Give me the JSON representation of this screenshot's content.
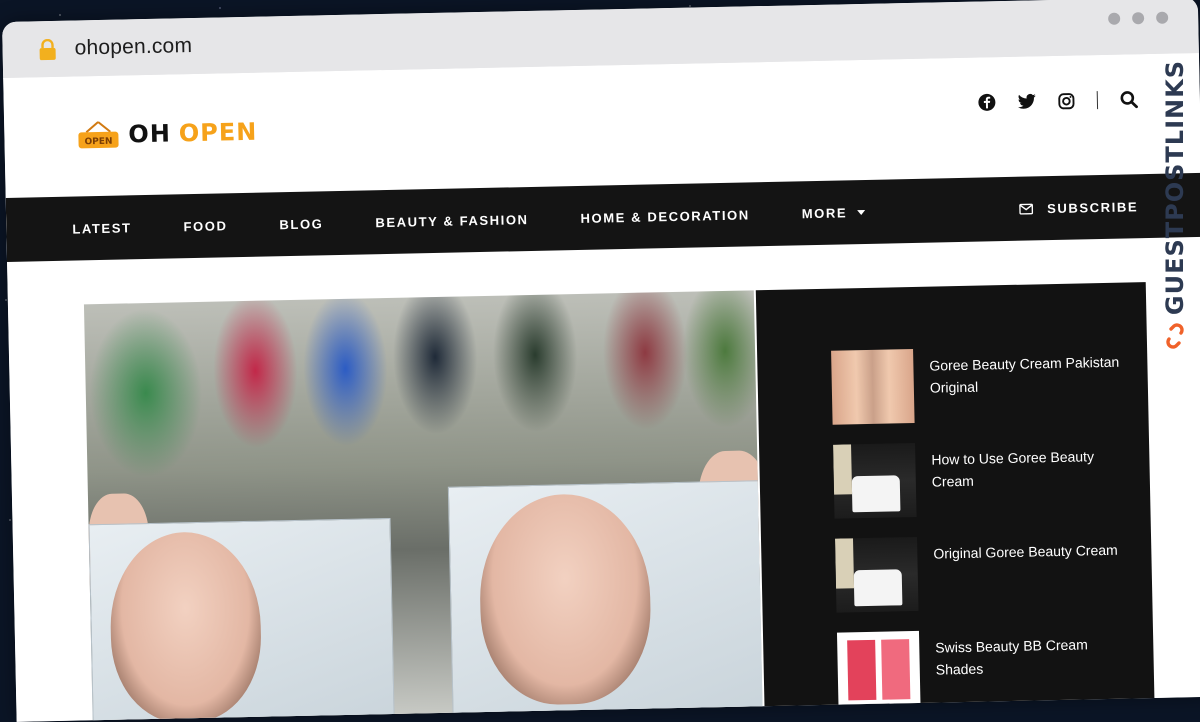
{
  "browser": {
    "url": "ohopen.com"
  },
  "header": {
    "logo_word1": "OH",
    "logo_word2": "OPEN",
    "social_icons": [
      "facebook-icon",
      "twitter-icon",
      "instagram-icon"
    ],
    "search_icon": "search-icon"
  },
  "nav": {
    "items": [
      {
        "label": "LATEST"
      },
      {
        "label": "FOOD"
      },
      {
        "label": "BLOG"
      },
      {
        "label": "BEAUTY & FASHION"
      },
      {
        "label": "HOME & DECORATION"
      },
      {
        "label": "MORE"
      }
    ],
    "subscribe_label": "SUBSCRIBE"
  },
  "sidebar": {
    "posts": [
      {
        "title": "Goree Beauty Cream Pakistan Original"
      },
      {
        "title": "How to Use Goree Beauty Cream"
      },
      {
        "title": "Original Goree Beauty Cream"
      },
      {
        "title": "Swiss Beauty BB Cream Shades"
      }
    ]
  },
  "watermark": {
    "text": "GUESTPOSTLINKS"
  },
  "colors": {
    "accent": "#f6a21a",
    "nav_bg": "#141414",
    "sidebar_bg": "#121212"
  }
}
